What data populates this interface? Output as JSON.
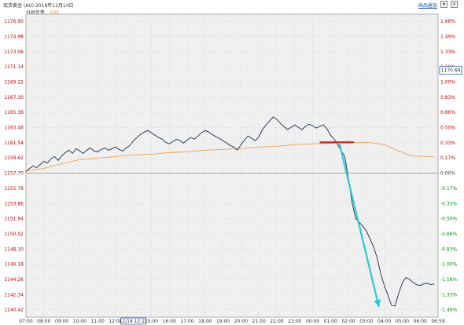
{
  "header": {
    "title": "现货黄金 (AU) 2016年12月14日",
    "link": "画品叠加",
    "close_label": "×",
    "menu_label": "▾"
  },
  "legend": {
    "price": "分时走势",
    "avg": "均线"
  },
  "colors": {
    "price_line": "#1c2c4c",
    "avg_line": "#f0a050",
    "annotation_line": "#e02020",
    "trend_arrow": "#2cc8d8",
    "grid": "#d8d8d8",
    "plot_bg": "#f0f0f0",
    "up_text": "#c00000",
    "down_text": "#009000"
  },
  "chart_data": {
    "type": "line",
    "title": "现货黄金 (AU) 2016年12月14日",
    "y_left_ticks": [
      "1176.90",
      "1174.98",
      "1173.06",
      "1171.14",
      "1169.22",
      "1167.30",
      "1165.38",
      "1163.46",
      "1161.54",
      "1159.62",
      "1157.70",
      "1155.78",
      "1153.86",
      "1151.94",
      "1150.02",
      "1148.10",
      "1146.18",
      "1144.26",
      "1142.34",
      "1140.42"
    ],
    "y_right_ticks": [
      "1.66%",
      "1.49%",
      "1.33%",
      "1.16%",
      "1.00%",
      "0.83%",
      "0.66%",
      "0.50%",
      "0.33%",
      "0.17%",
      "0.00%",
      "-0.17%",
      "-0.33%",
      "-0.50%",
      "-0.66%",
      "-0.83%",
      "-1.00%",
      "-1.16%",
      "-1.33%",
      "-1.49%"
    ],
    "ylim": [
      1139.5,
      1177.8
    ],
    "prev_close": 1157.7,
    "x_labels": [
      "07:00",
      "08:00",
      "09:00",
      "10:00",
      "11:00",
      "12:00",
      "12/14 12:21",
      "15:00",
      "16:00",
      "17:00",
      "18:00",
      "19:00",
      "20:00",
      "21:00",
      "22:00",
      "23:00",
      "00:00",
      "01:00",
      "02:00",
      "03:00",
      "04:00",
      "05:00",
      "06:00",
      "06:59"
    ],
    "highlighted_x_label": "12/14 12:21",
    "current_price_label": "1170.69",
    "price_series": {
      "name": "分时走势",
      "x": [
        0,
        0.2,
        0.4,
        0.6,
        0.8,
        1.0,
        1.2,
        1.4,
        1.6,
        1.8,
        2.0,
        2.2,
        2.4,
        2.6,
        2.8,
        3.0,
        3.2,
        3.4,
        3.6,
        3.8,
        4.0,
        4.2,
        4.4,
        4.6,
        4.8,
        5.0,
        5.2,
        5.4,
        5.6,
        5.8,
        6.0,
        6.2,
        6.4,
        6.6,
        6.8,
        7.0,
        7.2,
        7.4,
        7.6,
        7.8,
        8.0,
        8.2,
        8.4,
        8.6,
        8.8,
        9.0,
        9.2,
        9.4,
        9.6,
        9.8,
        10.0,
        10.2,
        10.4,
        10.6,
        10.8,
        11.0,
        11.2,
        11.4,
        11.6,
        11.8,
        12.0,
        12.2,
        12.4,
        12.6,
        12.8,
        13.0,
        13.2,
        13.4,
        13.6,
        13.8,
        14.0,
        14.2,
        14.4,
        14.6,
        14.8,
        15.0,
        15.2,
        15.4,
        15.6,
        15.8,
        16.0,
        16.2,
        16.4,
        16.6,
        16.8,
        17.0,
        17.2,
        17.4,
        17.6,
        17.8,
        18.0,
        18.2,
        18.4,
        18.6,
        18.8,
        19.0,
        19.2,
        19.4,
        19.6,
        19.8,
        20.0,
        20.2,
        20.4,
        20.6,
        20.8,
        21.0,
        21.2,
        21.4,
        21.6,
        21.8,
        22.0,
        22.2,
        22.4,
        22.6,
        22.8
      ],
      "values": [
        1157.9,
        1158.3,
        1158.6,
        1158.4,
        1158.8,
        1159.2,
        1159.0,
        1159.5,
        1159.8,
        1159.3,
        1159.9,
        1160.3,
        1160.6,
        1160.2,
        1160.8,
        1160.5,
        1160.2,
        1160.6,
        1160.9,
        1160.5,
        1160.4,
        1160.7,
        1160.9,
        1160.6,
        1160.8,
        1161.0,
        1160.7,
        1160.5,
        1160.9,
        1161.2,
        1161.8,
        1162.2,
        1162.6,
        1162.9,
        1163.1,
        1162.8,
        1162.5,
        1162.2,
        1162.0,
        1161.6,
        1161.4,
        1161.7,
        1162.0,
        1161.8,
        1161.5,
        1161.9,
        1162.2,
        1162.0,
        1162.4,
        1162.8,
        1163.1,
        1162.9,
        1162.6,
        1162.3,
        1162.1,
        1161.8,
        1161.5,
        1161.2,
        1161.0,
        1160.6,
        1161.3,
        1161.9,
        1162.4,
        1162.1,
        1161.8,
        1162.3,
        1163.2,
        1163.8,
        1164.3,
        1164.8,
        1164.5,
        1164.0,
        1163.6,
        1163.2,
        1163.5,
        1163.8,
        1163.5,
        1163.2,
        1163.6,
        1163.9,
        1163.7,
        1163.4,
        1163.6,
        1163.8,
        1163.3,
        1162.5,
        1162.0,
        1161.3,
        1160.5,
        1159.8,
        1157.0,
        1154.0,
        1152.0,
        1151.5,
        1151.0,
        1150.4,
        1149.4,
        1148.4,
        1147.0,
        1145.0,
        1143.5,
        1142.3,
        1141.0,
        1140.9,
        1142.5,
        1143.8,
        1144.5,
        1144.3,
        1143.9,
        1143.6,
        1143.5,
        1143.7,
        1143.8,
        1143.6,
        1143.7,
        1143.8
      ]
    },
    "avg_series": {
      "name": "均线",
      "x": [
        0,
        1,
        2,
        3,
        4,
        5,
        6,
        7,
        8,
        9,
        10,
        11,
        12,
        13,
        14,
        15,
        16,
        17,
        18,
        18.4,
        19,
        19.4,
        20,
        20.4,
        20.8,
        21.5,
        22.5,
        22.8
      ],
      "values": [
        1158.0,
        1158.3,
        1158.9,
        1159.4,
        1159.6,
        1159.8,
        1160.0,
        1160.1,
        1160.3,
        1160.4,
        1160.6,
        1160.7,
        1160.8,
        1161.0,
        1161.1,
        1161.3,
        1161.4,
        1161.5,
        1161.6,
        1161.6,
        1161.6,
        1161.5,
        1161.3,
        1160.9,
        1160.5,
        1159.9,
        1159.8,
        1159.8
      ]
    },
    "annotations": {
      "resistance": {
        "x_from": 16.4,
        "x_to": 18.3,
        "y": 1161.6
      },
      "trend_arrow": {
        "x_from": 17.5,
        "y_from": 1161.4,
        "x_to": 19.7,
        "y_to": 1140.8
      }
    }
  }
}
